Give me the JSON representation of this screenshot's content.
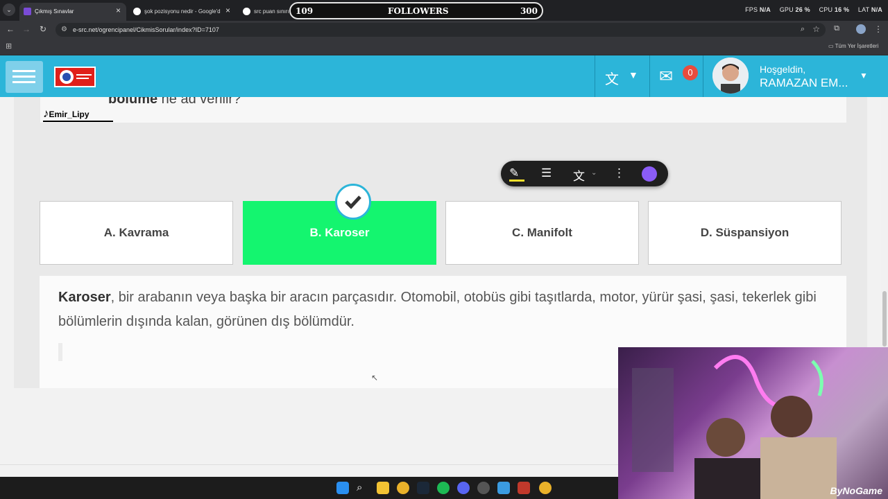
{
  "browser": {
    "tabs": [
      {
        "title": "Çıkmış Sınavlar",
        "favicon_color": "#7a4bd6"
      },
      {
        "title": "şok pozisyonu nedir - Google'd",
        "favicon_color": "#4285f4"
      },
      {
        "title": "src puan sınırı",
        "favicon_color": "#4285f4"
      }
    ],
    "url": "e-src.net/ogrencipanel/CikmisSorular/index?ID=7107",
    "bookmarks_folder": "Tüm Yer İşaretleri"
  },
  "overlay": {
    "followers_label": "FOLLOWERS",
    "followers_current": "109",
    "followers_goal": "300",
    "fps_label": "FPS",
    "fps_value": "N/A",
    "gpu_label": "GPU",
    "gpu_value": "26 %",
    "cpu_label": "CPU",
    "cpu_value": "16 %",
    "lat_label": "LAT",
    "lat_value": "N/A",
    "tiktok_handle": "Emir_Lipy",
    "stream_brand": "ByNoGame"
  },
  "header": {
    "mail_count": "0",
    "greeting": "Hoşgeldin,",
    "user_name": "RAMAZAN EM...",
    "accent_color": "#2cb5d9"
  },
  "question": {
    "text_bold": "bölüme",
    "text_rest": " ne ad verilir?"
  },
  "options": [
    {
      "label": "A. Kavrama",
      "correct": false
    },
    {
      "label": "B. Karoser",
      "correct": true
    },
    {
      "label": "C. Manifolt",
      "correct": false
    },
    {
      "label": "D. Süspansiyon",
      "correct": false
    }
  ],
  "explanation": {
    "term": "Karoser",
    "text": ", bir arabanın veya başka bir aracın parçasıdır. Otomobil, otobüs gibi taşıtlarda, motor, yürür şasi, şasi, tekerlek gibi bölümlerin dışında kalan, görünen dış bölümdür."
  },
  "colors": {
    "correct": "#14f56f"
  }
}
